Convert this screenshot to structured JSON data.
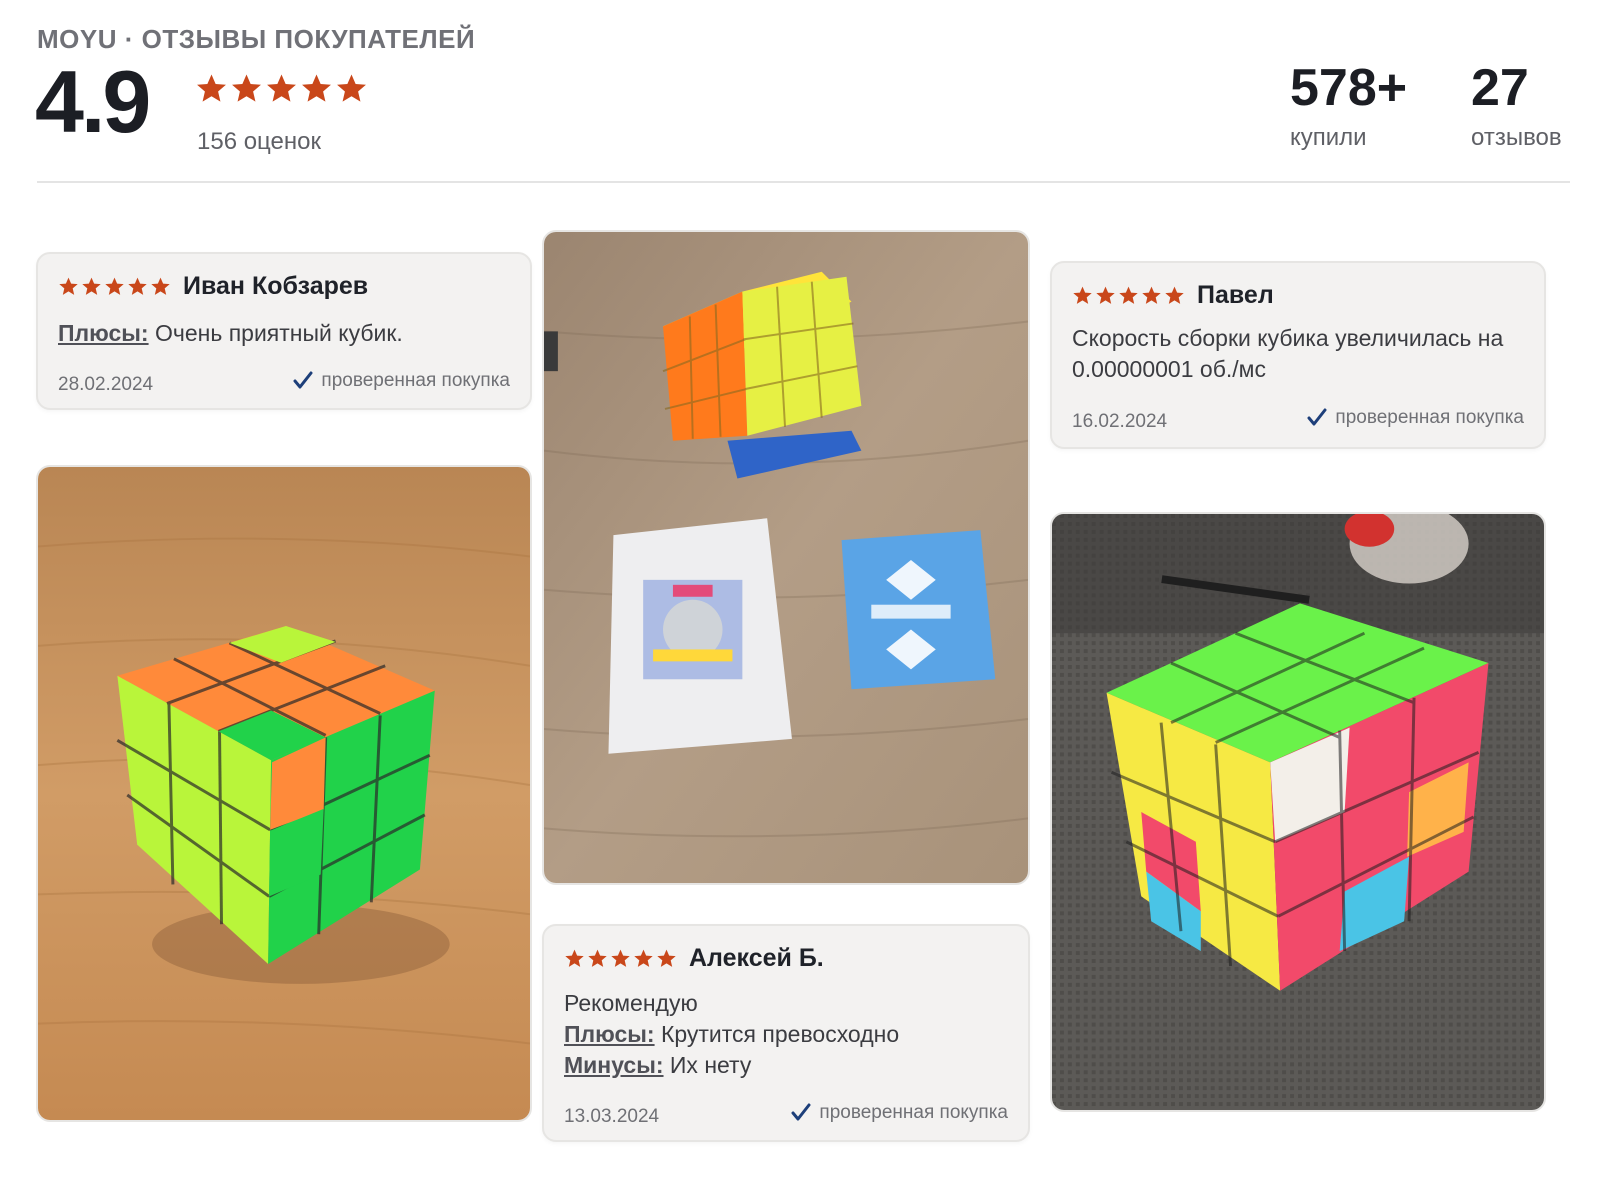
{
  "header": {
    "brand": "MOYU · ОТЗЫВЫ ПОКУПАТЕЛЕЙ",
    "rating": "4.9",
    "rating_stars": 5,
    "ratings_count": "156 оценок",
    "stats": [
      {
        "value": "578+",
        "label": "купили"
      },
      {
        "value": "27",
        "label": "отзывов"
      }
    ]
  },
  "colors": {
    "star": "#c9471a",
    "verified_check": "#1d3f7a"
  },
  "reviews": [
    {
      "author": "Иван Кобзарев",
      "stars": 5,
      "lines": [
        {
          "label": "Плюсы:",
          "text": " Очень приятный кубик."
        }
      ],
      "date": "28.02.2024",
      "verified": "проверенная покупка"
    },
    {
      "author": "Павел",
      "stars": 5,
      "lines": [
        {
          "label": "",
          "text": "Скорость сборки кубика увеличилась на 0.00000001 об./мс"
        }
      ],
      "date": "16.02.2024",
      "verified": "проверенная покупка"
    },
    {
      "author": "Алексей Б.",
      "stars": 5,
      "lines": [
        {
          "label": "",
          "text": "Рекомендую"
        },
        {
          "label": "Плюсы:",
          "text": " Крутится превосходно"
        },
        {
          "label": "Минусы:",
          "text": " Их нету"
        }
      ],
      "date": "13.03.2024",
      "verified": "проверенная покупка"
    }
  ],
  "photos": [
    {
      "subject": "rubiks-cube-on-wooden-table"
    },
    {
      "subject": "cube-on-stand-with-boxes"
    },
    {
      "subject": "rubiks-cube-on-gray-surface"
    }
  ]
}
